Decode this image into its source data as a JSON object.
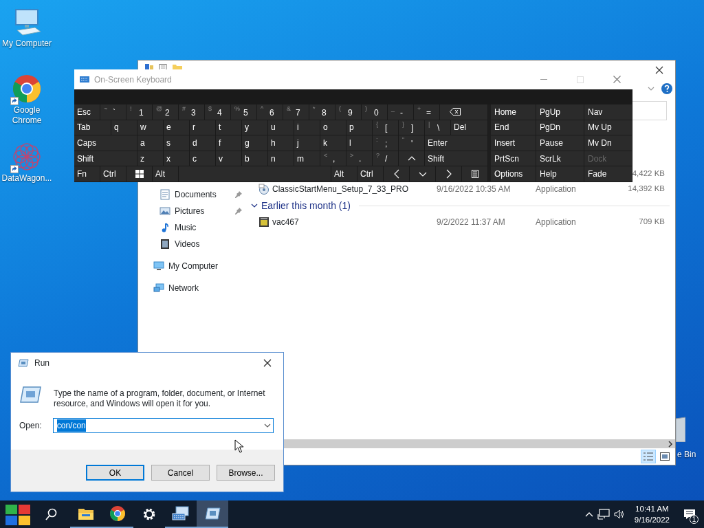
{
  "desktop_icons": [
    {
      "label": "My Computer",
      "kind": "computer",
      "shortcut": false
    },
    {
      "label": "Google Chrome",
      "kind": "chrome",
      "shortcut": true
    },
    {
      "label": "DataWagon...",
      "kind": "datawagon",
      "shortcut": true
    }
  ],
  "recycle_bin": {
    "label": "e Bin"
  },
  "explorer": {
    "quick_access": [
      {
        "label": "Documents",
        "kind": "documents",
        "pinned": true
      },
      {
        "label": "Pictures",
        "kind": "pictures",
        "pinned": true
      },
      {
        "label": "Music",
        "kind": "music",
        "pinned": false
      },
      {
        "label": "Videos",
        "kind": "videos",
        "pinned": false
      }
    ],
    "locations": [
      {
        "label": "My Computer",
        "kind": "computer"
      },
      {
        "label": "Network",
        "kind": "network"
      }
    ],
    "file_groups": [
      {
        "files": [
          {
            "size": "4,422 KB"
          },
          {
            "name": "ClassicStartMenu_Setup_7_33_PRO",
            "kind": "setup",
            "date": "9/16/2022 10:35 AM",
            "type": "Application",
            "size": "14,392 KB"
          }
        ]
      },
      {
        "header": "Earlier this month (1)",
        "expanded": true,
        "files": [
          {
            "name": "vac467",
            "kind": "app",
            "date": "9/2/2022 11:37 AM",
            "type": "Application",
            "size": "709 KB"
          }
        ]
      }
    ]
  },
  "keyboard": {
    "title": "On-Screen Keyboard",
    "rows": [
      [
        {
          "kind": "key",
          "label": "Esc"
        },
        {
          "kind": "key",
          "shift": "~",
          "label": "`"
        },
        {
          "kind": "key",
          "shift": "!",
          "label": "1"
        },
        {
          "kind": "key",
          "shift": "@",
          "label": "2"
        },
        {
          "kind": "key",
          "shift": "#",
          "label": "3"
        },
        {
          "kind": "key",
          "shift": "$",
          "label": "4"
        },
        {
          "kind": "key",
          "shift": "%",
          "label": "5"
        },
        {
          "kind": "key",
          "shift": "^",
          "label": "6"
        },
        {
          "kind": "key",
          "shift": "&",
          "label": "7"
        },
        {
          "kind": "key",
          "shift": "*",
          "label": "8"
        },
        {
          "kind": "key",
          "shift": "(",
          "label": "9"
        },
        {
          "kind": "key",
          "shift": ")",
          "label": "0"
        },
        {
          "kind": "key",
          "shift": "_",
          "label": "-"
        },
        {
          "kind": "key",
          "shift": "+",
          "label": "="
        },
        {
          "kind": "backspace"
        }
      ],
      [
        {
          "kind": "mod",
          "label": "Tab"
        },
        {
          "kind": "key",
          "label": "q"
        },
        {
          "kind": "key",
          "label": "w"
        },
        {
          "kind": "key",
          "label": "e"
        },
        {
          "kind": "key",
          "label": "r"
        },
        {
          "kind": "key",
          "label": "t"
        },
        {
          "kind": "key",
          "label": "y"
        },
        {
          "kind": "key",
          "label": "u"
        },
        {
          "kind": "key",
          "label": "i"
        },
        {
          "kind": "key",
          "label": "o"
        },
        {
          "kind": "key",
          "label": "p"
        },
        {
          "kind": "key",
          "shift": "{",
          "label": "["
        },
        {
          "kind": "key",
          "shift": "}",
          "label": "]"
        },
        {
          "kind": "key",
          "shift": "|",
          "label": "\\"
        },
        {
          "kind": "mod",
          "label": "Del"
        }
      ],
      [
        {
          "kind": "mod",
          "label": "Caps"
        },
        {
          "kind": "key",
          "label": "a"
        },
        {
          "kind": "key",
          "label": "s"
        },
        {
          "kind": "key",
          "label": "d"
        },
        {
          "kind": "key",
          "label": "f"
        },
        {
          "kind": "key",
          "label": "g"
        },
        {
          "kind": "key",
          "label": "h"
        },
        {
          "kind": "key",
          "label": "j"
        },
        {
          "kind": "key",
          "label": "k"
        },
        {
          "kind": "key",
          "label": "l"
        },
        {
          "kind": "key",
          "shift": ":",
          "label": ";"
        },
        {
          "kind": "key",
          "shift": "\"",
          "label": "'"
        },
        {
          "kind": "mod",
          "label": "Enter"
        }
      ],
      [
        {
          "kind": "mod",
          "label": "Shift"
        },
        {
          "kind": "key",
          "label": "z"
        },
        {
          "kind": "key",
          "label": "x"
        },
        {
          "kind": "key",
          "label": "c"
        },
        {
          "kind": "key",
          "label": "v"
        },
        {
          "kind": "key",
          "label": "b"
        },
        {
          "kind": "key",
          "label": "n"
        },
        {
          "kind": "key",
          "label": "m"
        },
        {
          "kind": "key",
          "shift": "<",
          "label": ","
        },
        {
          "kind": "key",
          "shift": ">",
          "label": "."
        },
        {
          "kind": "key",
          "shift": "?",
          "label": "/"
        },
        {
          "kind": "up"
        },
        {
          "kind": "mod",
          "label": "Shift"
        }
      ],
      [
        {
          "kind": "key",
          "label": "Fn"
        },
        {
          "kind": "key",
          "label": "Ctrl"
        },
        {
          "kind": "windows"
        },
        {
          "kind": "key",
          "label": "Alt"
        },
        {
          "kind": "space"
        },
        {
          "kind": "key",
          "label": "Alt"
        },
        {
          "kind": "key",
          "label": "Ctrl"
        },
        {
          "kind": "left"
        },
        {
          "kind": "down"
        },
        {
          "kind": "right"
        },
        {
          "kind": "menu"
        }
      ]
    ],
    "nav_keys": [
      {
        "label": "Home",
        "disabled": false
      },
      {
        "label": "PgUp",
        "disabled": false
      },
      {
        "label": "Nav",
        "disabled": false
      },
      {
        "label": "End",
        "disabled": false
      },
      {
        "label": "PgDn",
        "disabled": false
      },
      {
        "label": "Mv Up",
        "disabled": false
      },
      {
        "label": "Insert",
        "disabled": false
      },
      {
        "label": "Pause",
        "disabled": false
      },
      {
        "label": "Mv Dn",
        "disabled": false
      },
      {
        "label": "PrtScn",
        "disabled": false
      },
      {
        "label": "ScrLk",
        "disabled": false
      },
      {
        "label": "Dock",
        "disabled": true
      },
      {
        "label": "Options",
        "disabled": false
      },
      {
        "label": "Help",
        "disabled": false
      },
      {
        "label": "Fade",
        "disabled": false
      }
    ]
  },
  "run": {
    "title": "Run",
    "message": "Type the name of a program, folder, document, or Internet resource, and Windows will open it for you.",
    "open_label": "Open:",
    "open_field": {
      "value": "con/con",
      "text_selected": true
    },
    "buttons": [
      {
        "label": "OK",
        "default": true
      },
      {
        "label": "Cancel",
        "default": false
      },
      {
        "label": "Browse...",
        "default": false
      }
    ]
  },
  "taskbar": {
    "items": [
      {
        "kind": "start",
        "open": false,
        "selected": false
      },
      {
        "kind": "search",
        "open": false,
        "selected": false
      },
      {
        "kind": "explorer",
        "open": true,
        "selected": false
      },
      {
        "kind": "chrome",
        "open": true,
        "selected": false
      },
      {
        "kind": "settings",
        "open": false,
        "selected": false
      },
      {
        "kind": "keyboard",
        "open": true,
        "selected": false
      },
      {
        "kind": "run",
        "open": true,
        "selected": true
      }
    ],
    "time": "10:41 AM",
    "date": "9/16/2022",
    "notifications": "1"
  }
}
